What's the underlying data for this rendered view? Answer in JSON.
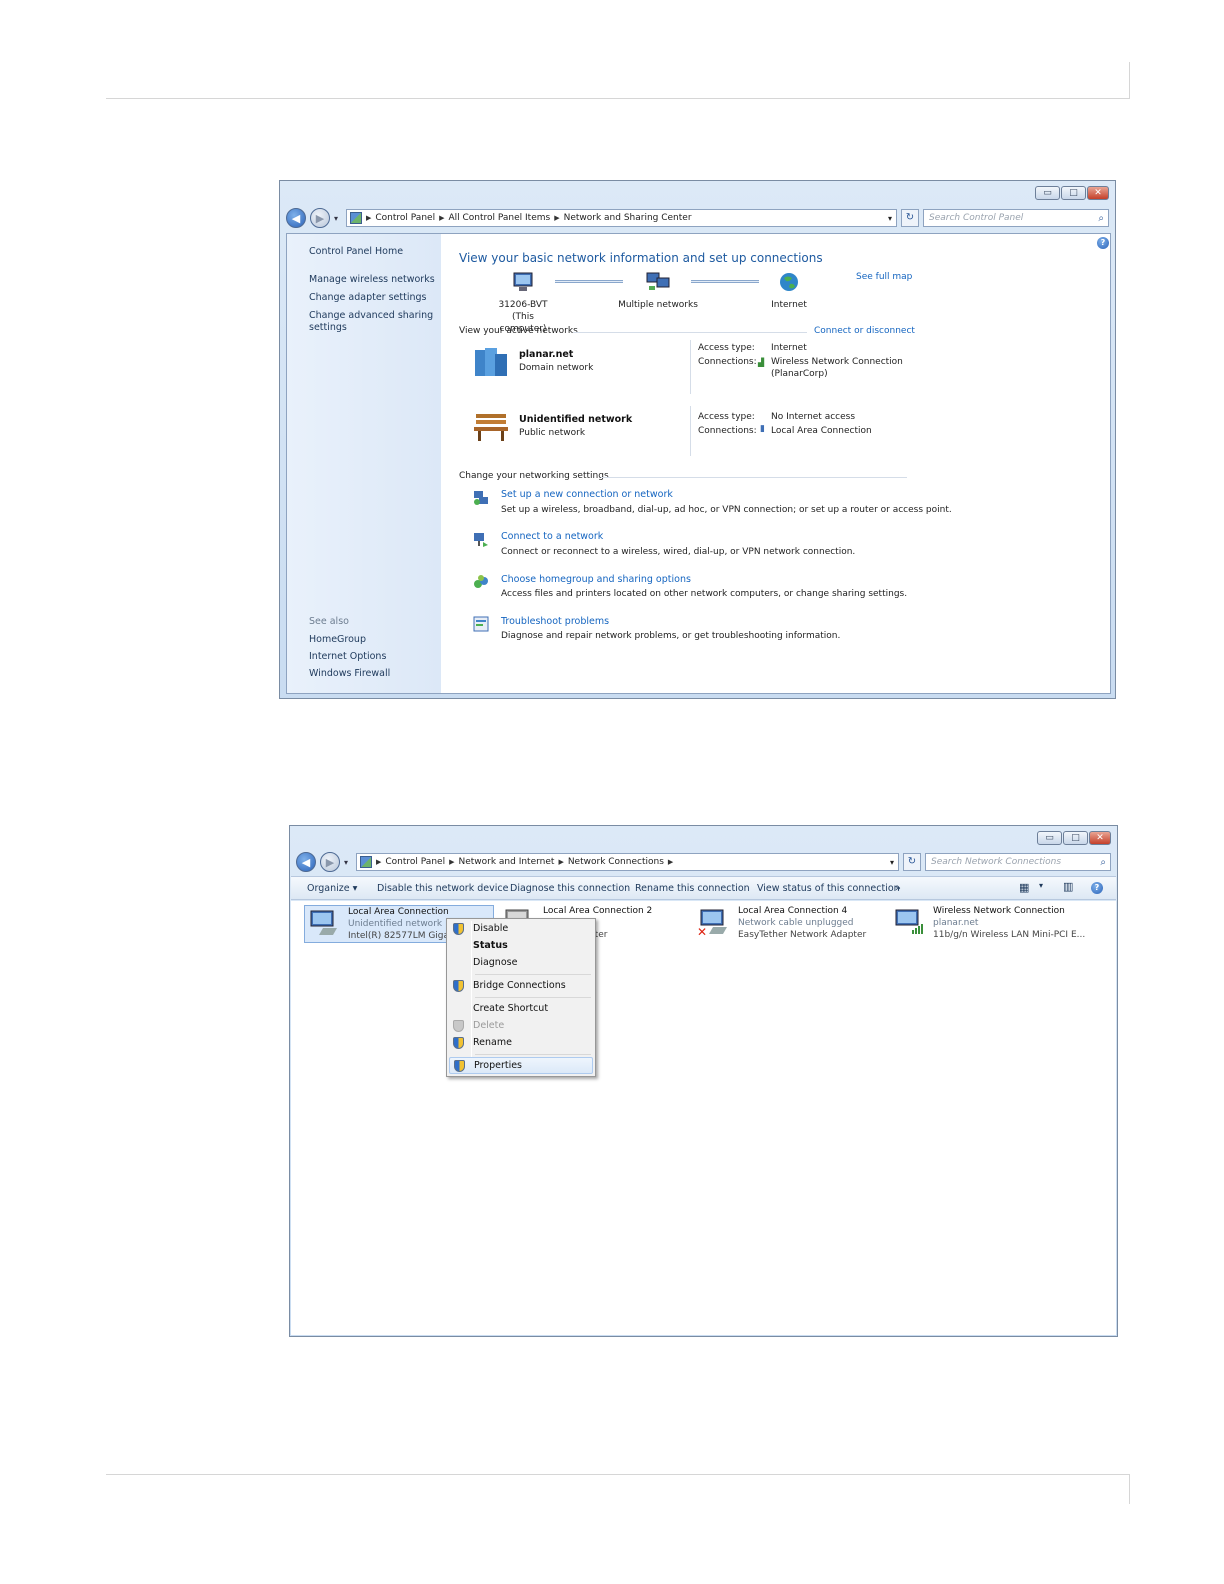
{
  "window1": {
    "caption": {
      "minimize": "▭",
      "maximize": "□",
      "close": "✕"
    },
    "address": {
      "crumbs": [
        "Control Panel",
        "All Control Panel Items",
        "Network and Sharing Center"
      ],
      "search_placeholder": "Search Control Panel"
    },
    "left_pane": {
      "home": "Control Panel Home",
      "links": [
        "Manage wireless networks",
        "Change adapter settings",
        "Change advanced sharing",
        "settings"
      ],
      "see_also_heading": "See also",
      "see_also": [
        "HomeGroup",
        "Internet Options",
        "Windows Firewall"
      ]
    },
    "main": {
      "title": "View your basic network information and set up connections",
      "see_full_map": "See full map",
      "map": {
        "computer_name": "31206-BVT",
        "computer_sub": "(This computer)",
        "middle": "Multiple networks",
        "internet": "Internet"
      },
      "active_networks_heading": "View your active networks",
      "connect_or_disconnect": "Connect or disconnect",
      "networks": [
        {
          "name": "planar.net",
          "type": "Domain network",
          "access_label": "Access type:",
          "access": "Internet",
          "connections_label": "Connections:",
          "connection": "Wireless Network Connection",
          "connection2": "(PlanarCorp)"
        },
        {
          "name": "Unidentified network",
          "type": "Public network",
          "access_label": "Access type:",
          "access": "No Internet access",
          "connections_label": "Connections:",
          "connection": "Local Area Connection"
        }
      ],
      "change_settings_heading": "Change your networking settings",
      "tasks": [
        {
          "link": "Set up a new connection or network",
          "desc": "Set up a wireless, broadband, dial-up, ad hoc, or VPN connection; or set up a router or access point."
        },
        {
          "link": "Connect to a network",
          "desc": "Connect or reconnect to a wireless, wired, dial-up, or VPN network connection."
        },
        {
          "link": "Choose homegroup and sharing options",
          "desc": "Access files and printers located on other network computers, or change sharing settings."
        },
        {
          "link": "Troubleshoot problems",
          "desc": "Diagnose and repair network problems, or get troubleshooting information."
        }
      ]
    }
  },
  "window2": {
    "caption": {
      "minimize": "▭",
      "maximize": "□",
      "close": "✕"
    },
    "address": {
      "crumbs": [
        "Control Panel",
        "Network and Internet",
        "Network Connections"
      ],
      "search_placeholder": "Search Network Connections"
    },
    "commands": [
      "Organize ▾",
      "Disable this network device",
      "Diagnose this connection",
      "Rename this connection",
      "View status of this connection",
      "»"
    ],
    "connections": [
      {
        "name": "Local Area Connection",
        "status": "Unidentified network",
        "adapter": "Intel(R) 82577LM Gigabit"
      },
      {
        "name": "Local Area Connection 2",
        "status": "",
        "adapter": "s VPN Adapter"
      },
      {
        "name": "Local Area Connection 4",
        "status": "Network cable unplugged",
        "adapter": "EasyTether Network Adapter"
      },
      {
        "name": "Wireless Network Connection",
        "status": "planar.net",
        "adapter": "11b/g/n  Wireless LAN Mini-PCI E..."
      }
    ],
    "context_menu": [
      "Disable",
      "Status",
      "Diagnose",
      "Bridge Connections",
      "Create Shortcut",
      "Delete",
      "Rename",
      "Properties"
    ]
  },
  "colors": {
    "link": "#1565c0",
    "title": "#1e5aa0",
    "selection": "#d9e8fa"
  }
}
